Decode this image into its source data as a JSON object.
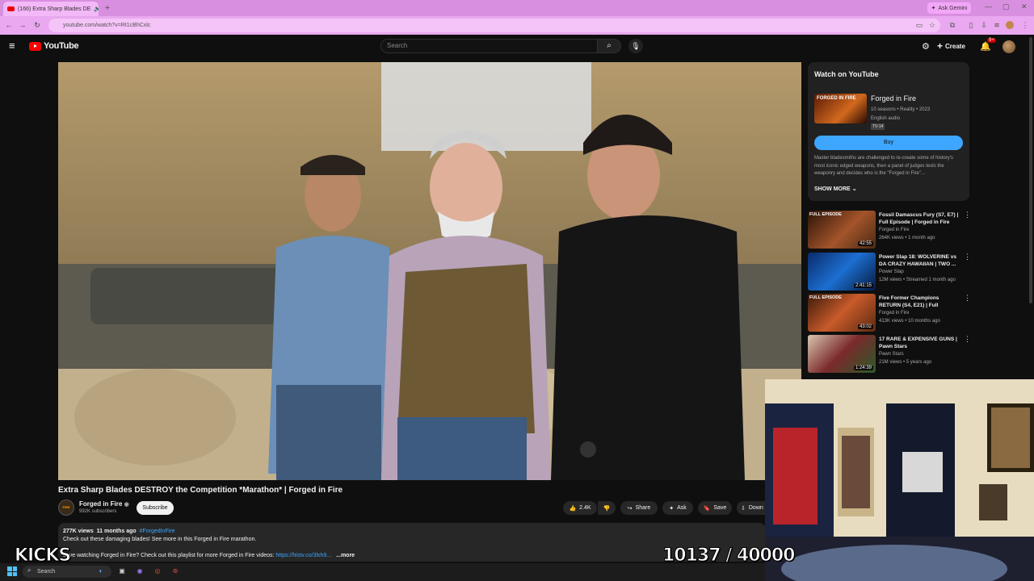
{
  "browser": {
    "tab_title": "(166) Extra Sharp Blades DE",
    "new_tab": "+",
    "url": "youtube.com/watch?v=Rt1cBhCxlc",
    "ask_gemini": "Ask Gemini"
  },
  "header": {
    "logo_text": "YouTube",
    "search_placeholder": "Search",
    "create_label": "Create",
    "notification_count": "9+"
  },
  "video": {
    "title": "Extra Sharp Blades DESTROY the Competition *Marathon* | Forged in Fire",
    "channel_name": "Forged in Fire",
    "subscribers": "992K subscribers",
    "subscribe_label": "Subscribe",
    "likes": "2.4K",
    "share_label": "Share",
    "ask_label": "Ask",
    "save_label": "Save",
    "download_label": "Down",
    "views": "277K views",
    "date": "11 months ago",
    "hashtag": "#ForgedInFire",
    "desc_line1": "Check out these damaging blades! See more in this Forged in Fire marathon.",
    "desc_line2_prefix": "Love watching Forged in Fire? Check out this playlist for more Forged in Fire videos:",
    "desc_link": "https://histv.co/3lsh9...",
    "more_label": "...more"
  },
  "watch_panel": {
    "heading": "Watch on YouTube",
    "thumb_text": "FORGED IN FIRE",
    "show_title": "Forged in Fire",
    "meta1": "10 seasons • Reality • 2023",
    "meta2": "English audio",
    "rating": "TV-14",
    "buy_label": "Buy",
    "description": "Master bladesmiths are challenged to re-create some of history's most iconic edged weapons, then a panel of judges tests the weaponry and decides who is the \"Forged in Fire\"...",
    "show_more": "SHOW MORE"
  },
  "recommendations": [
    {
      "badge": "FULL EPISODE",
      "title": "Fossil Damascus Fury (S7, E7) | Full Episode | Forged in Fire",
      "channel": "Forged in Fire",
      "meta": "264K views • 1 month ago",
      "duration": "42:55"
    },
    {
      "badge": "",
      "title": "Power Slap 18: WOLVERINE vs DA CRAZY HAWAIIAN | TWO ...",
      "channel": "Power Slap",
      "meta": "12M views • Streamed 1 month ago",
      "duration": "2:41:15"
    },
    {
      "badge": "FULL EPISODE",
      "title": "Five Former Champions RETURN (S4, E21) | Full Episod...",
      "channel": "Forged in Fire",
      "meta": "413K views • 10 months ago",
      "duration": "43:02"
    },
    {
      "badge": "",
      "title": "17 RARE & EXPENSIVE GUNS | Pawn Stars",
      "channel": "Pawn Stars",
      "meta": "21M views • 5 years ago",
      "duration": "1:24:39"
    }
  ],
  "overlay": {
    "left_text": "KICKS",
    "counter": "10137 / 40000"
  },
  "taskbar": {
    "search_label": "Search"
  },
  "colors": {
    "accent_blue": "#3ea6ff",
    "youtube_red": "#ff0000",
    "browser_pink": "#d98fe0"
  }
}
